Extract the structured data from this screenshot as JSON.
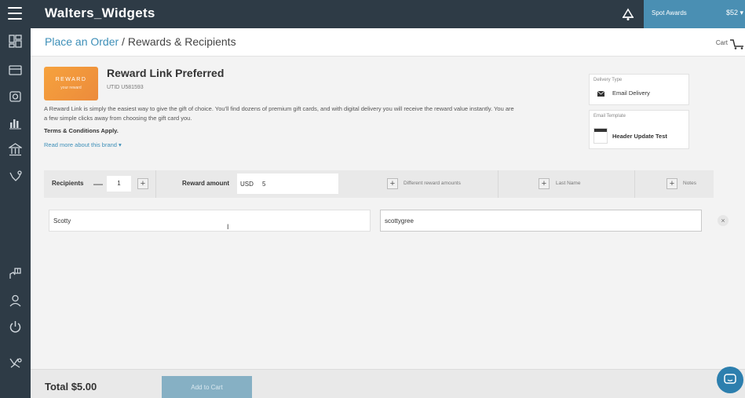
{
  "app": {
    "title": "Walters_Widgets"
  },
  "topbar": {
    "spot_awards_label": "Spot Awards",
    "balance": "$52 ▾"
  },
  "header": {
    "breadcrumb_link": "Place an Order",
    "breadcrumb_sep": " / ",
    "breadcrumb_current": "Rewards & Recipients",
    "cart_label": "Cart"
  },
  "reward": {
    "thumb_title": "REWARD",
    "thumb_sub": "your reward",
    "title": "Reward Link Preferred",
    "utid": "UTID U581593",
    "description": "A Reward Link is simply the easiest way to give the gift of choice. You'll find dozens of premium gift cards, and with digital delivery you will receive the reward value instantly. You are a few simple clicks away from choosing the gift card you.",
    "terms": "Terms & Conditions Apply.",
    "read_more": "Read more about this brand ▾"
  },
  "delivery": {
    "label": "Delivery Type",
    "value": "Email Delivery"
  },
  "email_template": {
    "label": "Email Template",
    "value": "Header Update Test"
  },
  "recipients_bar": {
    "recipients_label": "Recipients",
    "minus": "—",
    "quantity": "1",
    "plus": "+",
    "reward_amount_label": "Reward amount",
    "currency": "USD",
    "amount": "5",
    "different_amounts": "Different reward amounts",
    "last_name": "Last Name",
    "notes": "Notes"
  },
  "recipient_row": {
    "first_name": "Scotty",
    "email": "scottygree",
    "remove": "×"
  },
  "footer": {
    "total": "Total $5.00",
    "add_to_cart": "Add to Cart"
  },
  "icons": [
    "menu-icon",
    "bell-icon",
    "dashboard-icon",
    "card-icon",
    "gift-icon",
    "chart-icon",
    "bank-icon",
    "handshake-icon",
    "hands-icon",
    "user-icon",
    "power-icon",
    "support-icon",
    "cart-icon",
    "mail-icon",
    "chat-icon"
  ]
}
